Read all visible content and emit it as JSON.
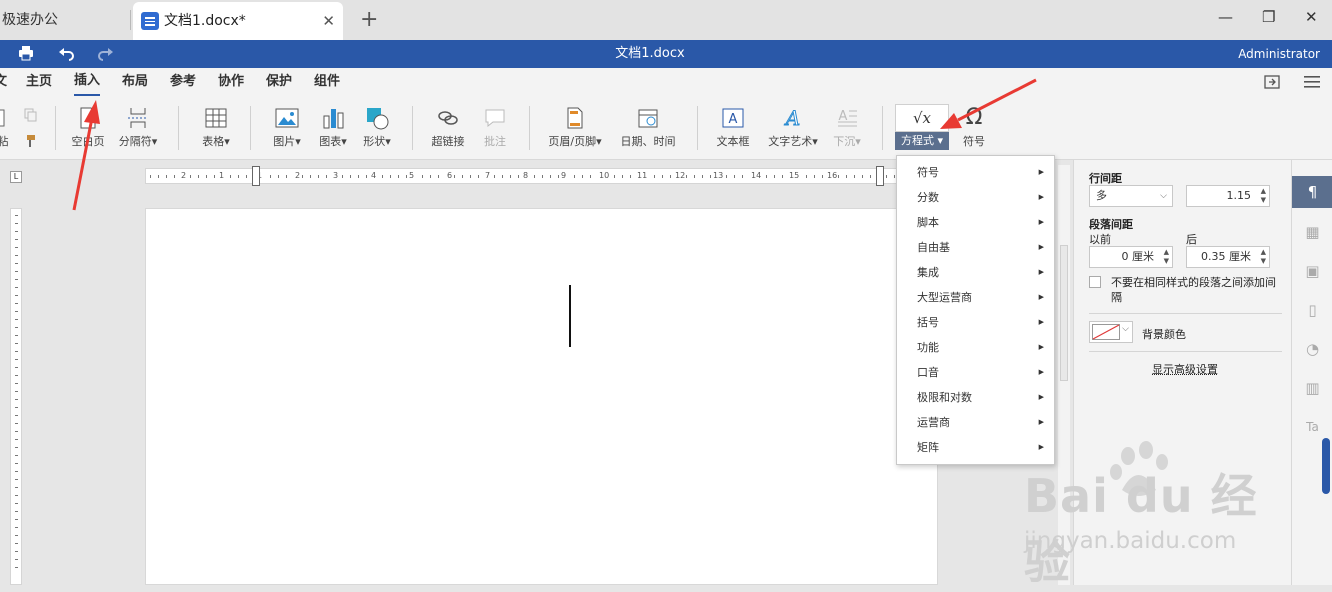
{
  "tabs": [
    {
      "label": "极速办公"
    },
    {
      "label": "文档1.docx*",
      "close": "✕"
    }
  ],
  "window": {
    "new_tab": "+",
    "minimize": "—",
    "restore": "❐",
    "close": "✕"
  },
  "titlebar": {
    "title": "文档1.docx",
    "user": "Administrator",
    "print_icon": "print-icon",
    "undo_icon": "undo-icon",
    "redo_icon": "redo-icon"
  },
  "menu": [
    "文",
    "主页",
    "插入",
    "布局",
    "参考",
    "协作",
    "保护",
    "组件"
  ],
  "menu_active": "插入",
  "toolbar": {
    "paste_partial": "粘",
    "blank_page": "空白页",
    "separator": "分隔符",
    "table": "表格",
    "image": "图片",
    "chart": "图表",
    "shape": "形状",
    "hyperlink": "超链接",
    "comment": "批注",
    "header_footer": "页眉/页脚",
    "date_time": "日期、时间",
    "textbox": "文本框",
    "wordart": "文字艺术",
    "dropcap": "下沉",
    "equation": "方程式",
    "equation_symbol": "√x",
    "symbol": "符号",
    "symbol_glyph": "Ω",
    "dropdown_glyph": "▾"
  },
  "ruler": {
    "numbers": [
      "2",
      "1",
      "1",
      "2",
      "3",
      "4",
      "5",
      "6",
      "7",
      "8",
      "9",
      "10",
      "11",
      "12",
      "13",
      "14",
      "15",
      "16"
    ],
    "corner": "L"
  },
  "equation_menu": {
    "items": [
      "符号",
      "分数",
      "脚本",
      "自由基",
      "集成",
      "大型运营商",
      "括号",
      "功能",
      "口音",
      "极限和对数",
      "运营商",
      "矩阵"
    ],
    "arrow": "▶"
  },
  "paragraph_panel": {
    "line_spacing_label": "行间距",
    "line_spacing_mode": "多",
    "line_spacing_value": "1.15",
    "para_spacing_label": "段落间距",
    "before_label": "以前",
    "after_label": "后",
    "before_value": "0 厘米",
    "after_value": "0.35 厘米",
    "no_space_checkbox": "不要在相同样式的段落之间添加间隔",
    "bg_color_label": "背景颜色",
    "advanced_link": "显示高级设置"
  },
  "sidebar_icons": [
    "paragraph-icon",
    "table-settings-icon",
    "image-settings-icon",
    "header-footer-icon",
    "shape-settings-icon",
    "chart-settings-icon",
    "textart-settings-icon"
  ],
  "watermark": {
    "logo": "Bai  du 经验",
    "site": "jingyan.baidu.com"
  },
  "colors": {
    "brand": "#2a58a8",
    "arrow": "#e83a33",
    "equation_btn": "#5b6f8e"
  }
}
